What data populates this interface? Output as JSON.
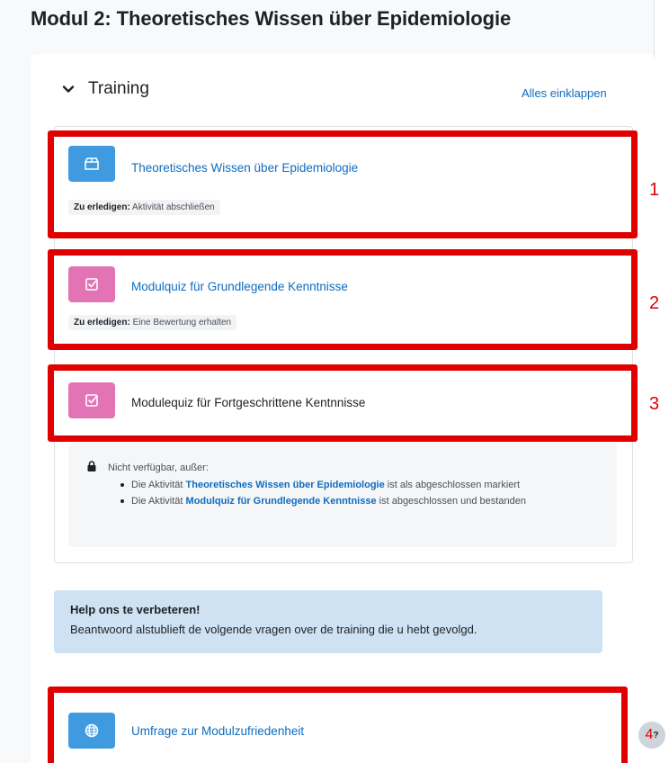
{
  "page": {
    "title": "Modul 2: Theoretisches Wissen über Epidemiologie"
  },
  "section": {
    "title": "Training",
    "collapse_all": "Alles einklappen"
  },
  "activities": [
    {
      "name": "Theoretisches Wissen über Epidemiologie",
      "todo_label": "Zu erledigen:",
      "todo_text": "Aktivität abschließen",
      "icon": "page-icon"
    },
    {
      "name": "Modulquiz für Grundlegende Kenntnisse",
      "todo_label": "Zu erledigen:",
      "todo_text": "Eine Bewertung erhalten",
      "icon": "quiz-icon"
    },
    {
      "name": "Modulequiz für Fortgeschrittene Kentnnisse",
      "icon": "quiz-icon"
    },
    {
      "name": "Umfrage zur Modulzufriedenheit",
      "icon": "globe-icon"
    }
  ],
  "restriction": {
    "heading": "Nicht verfügbar, außer:",
    "items": [
      {
        "prefix": "Die Aktivität ",
        "link": "Theoretisches Wissen über Epidemiologie",
        "suffix": " ist als abgeschlossen markiert"
      },
      {
        "prefix": "Die Aktivität ",
        "link": "Modulquiz für Grundlegende Kenntnisse",
        "suffix": " ist abgeschlossen und bestanden"
      }
    ]
  },
  "help": {
    "title": "Help ons te verbeteren!",
    "text": "Beantwoord alstublieft de volgende vragen over de training die u hebt gevolgd."
  },
  "annotations": [
    "1",
    "2",
    "3",
    "4"
  ],
  "colors": {
    "link": "#0f6cbf",
    "page_icon": "#3f9ae0",
    "quiz_icon": "#e274b5",
    "highlight": "#e00000",
    "help_bg": "#cfe2f3"
  }
}
